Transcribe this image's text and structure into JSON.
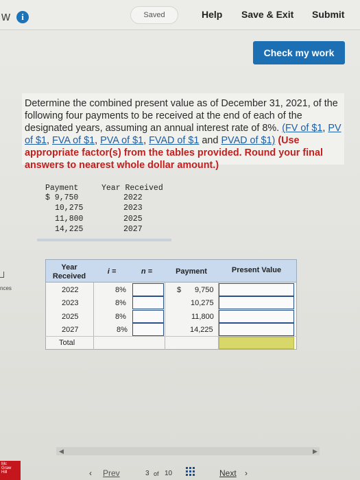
{
  "topbar": {
    "brand": "w",
    "info_glyph": "i",
    "saved": "Saved",
    "help": "Help",
    "save_exit": "Save & Exit",
    "submit": "Submit",
    "check_work": "Check my work"
  },
  "question": {
    "text_1": "Determine the combined present value as of December 31, 2021, of the following four payments to be received at the end of each of the designated years, assuming an annual interest rate of 8%. ",
    "link_fv": "(FV of $1",
    "link_pv": "PV of $1",
    "link_fva": "FVA of $1",
    "link_pva": "PVA of $1",
    "link_fvad": "FVAD of $1",
    "and": " and ",
    "link_pvad": "PVAD of $1)",
    "instruction": " (Use appropriate factor(s) from the tables provided. Round your final answers to nearest whole dollar amount.)"
  },
  "given": {
    "headers": [
      "Payment",
      "Year Received"
    ],
    "rows": [
      {
        "payment": "$ 9,750",
        "year": "2022"
      },
      {
        "payment": "10,275",
        "year": "2023"
      },
      {
        "payment": "11,800",
        "year": "2025"
      },
      {
        "payment": "14,225",
        "year": "2027"
      }
    ]
  },
  "left_strip": {
    "label": "nces"
  },
  "table": {
    "headers": {
      "year": "Year Received",
      "i": "i =",
      "n": "n =",
      "payment": "Payment",
      "pv": "Present Value"
    },
    "rows": [
      {
        "year": "2022",
        "i": "8%",
        "currency": "$",
        "payment": "9,750"
      },
      {
        "year": "2023",
        "i": "8%",
        "currency": "",
        "payment": "10,275"
      },
      {
        "year": "2025",
        "i": "8%",
        "currency": "",
        "payment": "11,800"
      },
      {
        "year": "2027",
        "i": "8%",
        "currency": "",
        "payment": "14,225"
      }
    ],
    "total_label": "Total"
  },
  "nav": {
    "prev": "Prev",
    "page_current": "3",
    "page_of": "of",
    "page_total": "10",
    "next": "Next"
  },
  "logo": {
    "line1": "Mc",
    "line2": "Graw",
    "line3": "Hill"
  },
  "colors": {
    "accent_blue": "#1d6fb4",
    "header_blue": "#c9d9ee",
    "total_yellow": "#d8d86a",
    "instruction_red": "#c32020",
    "link_blue": "#1d5fa8"
  }
}
